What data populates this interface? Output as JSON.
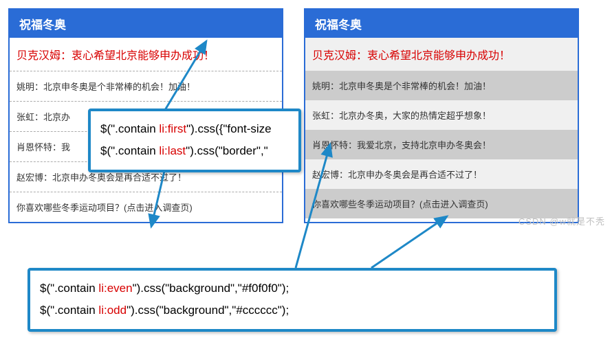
{
  "panels": {
    "left": {
      "title": "祝福冬奥",
      "items": [
        "贝克汉姆：衷心希望北京能够申办成功！",
        "姚明：北京申冬奥是个非常棒的机会！加油！",
        "张虹：北京办",
        "肖恩怀特：我",
        "赵宏博：北京申办冬奥会是再合适不过了！",
        "你喜欢哪些冬季运动项目？(点击进入调查页)"
      ]
    },
    "right": {
      "title": "祝福冬奥",
      "items": [
        "贝克汉姆：衷心希望北京能够申办成功！",
        "姚明：北京申冬奥是个非常棒的机会！加油！",
        "张虹：北京办冬奥，大家的热情定超乎想象！",
        "肖恩怀特：我爱北京，支持北京申办冬奥会！",
        "赵宏博：北京申办冬奥会是再合适不过了！",
        "你喜欢哪些冬季运动项目？(点击进入调查页)"
      ]
    }
  },
  "code_top": {
    "line1": {
      "pre": "$(\".contain ",
      "sel": "li:first",
      "post": "\").css({\"font-size"
    },
    "line2": {
      "pre": "$(\".contain ",
      "sel": "li:last",
      "post": "\").css(\"border\",\""
    }
  },
  "code_bot": {
    "line1": {
      "pre": "$(\".contain ",
      "sel": "li:even",
      "post": "\").css(\"background\",\"#f0f0f0\");"
    },
    "line2": {
      "pre": "$(\".contain ",
      "sel": "li:odd",
      "post": "\").css(\"background\",\"#cccccc\");"
    }
  },
  "watermark": "CSDN @w就是不秃"
}
